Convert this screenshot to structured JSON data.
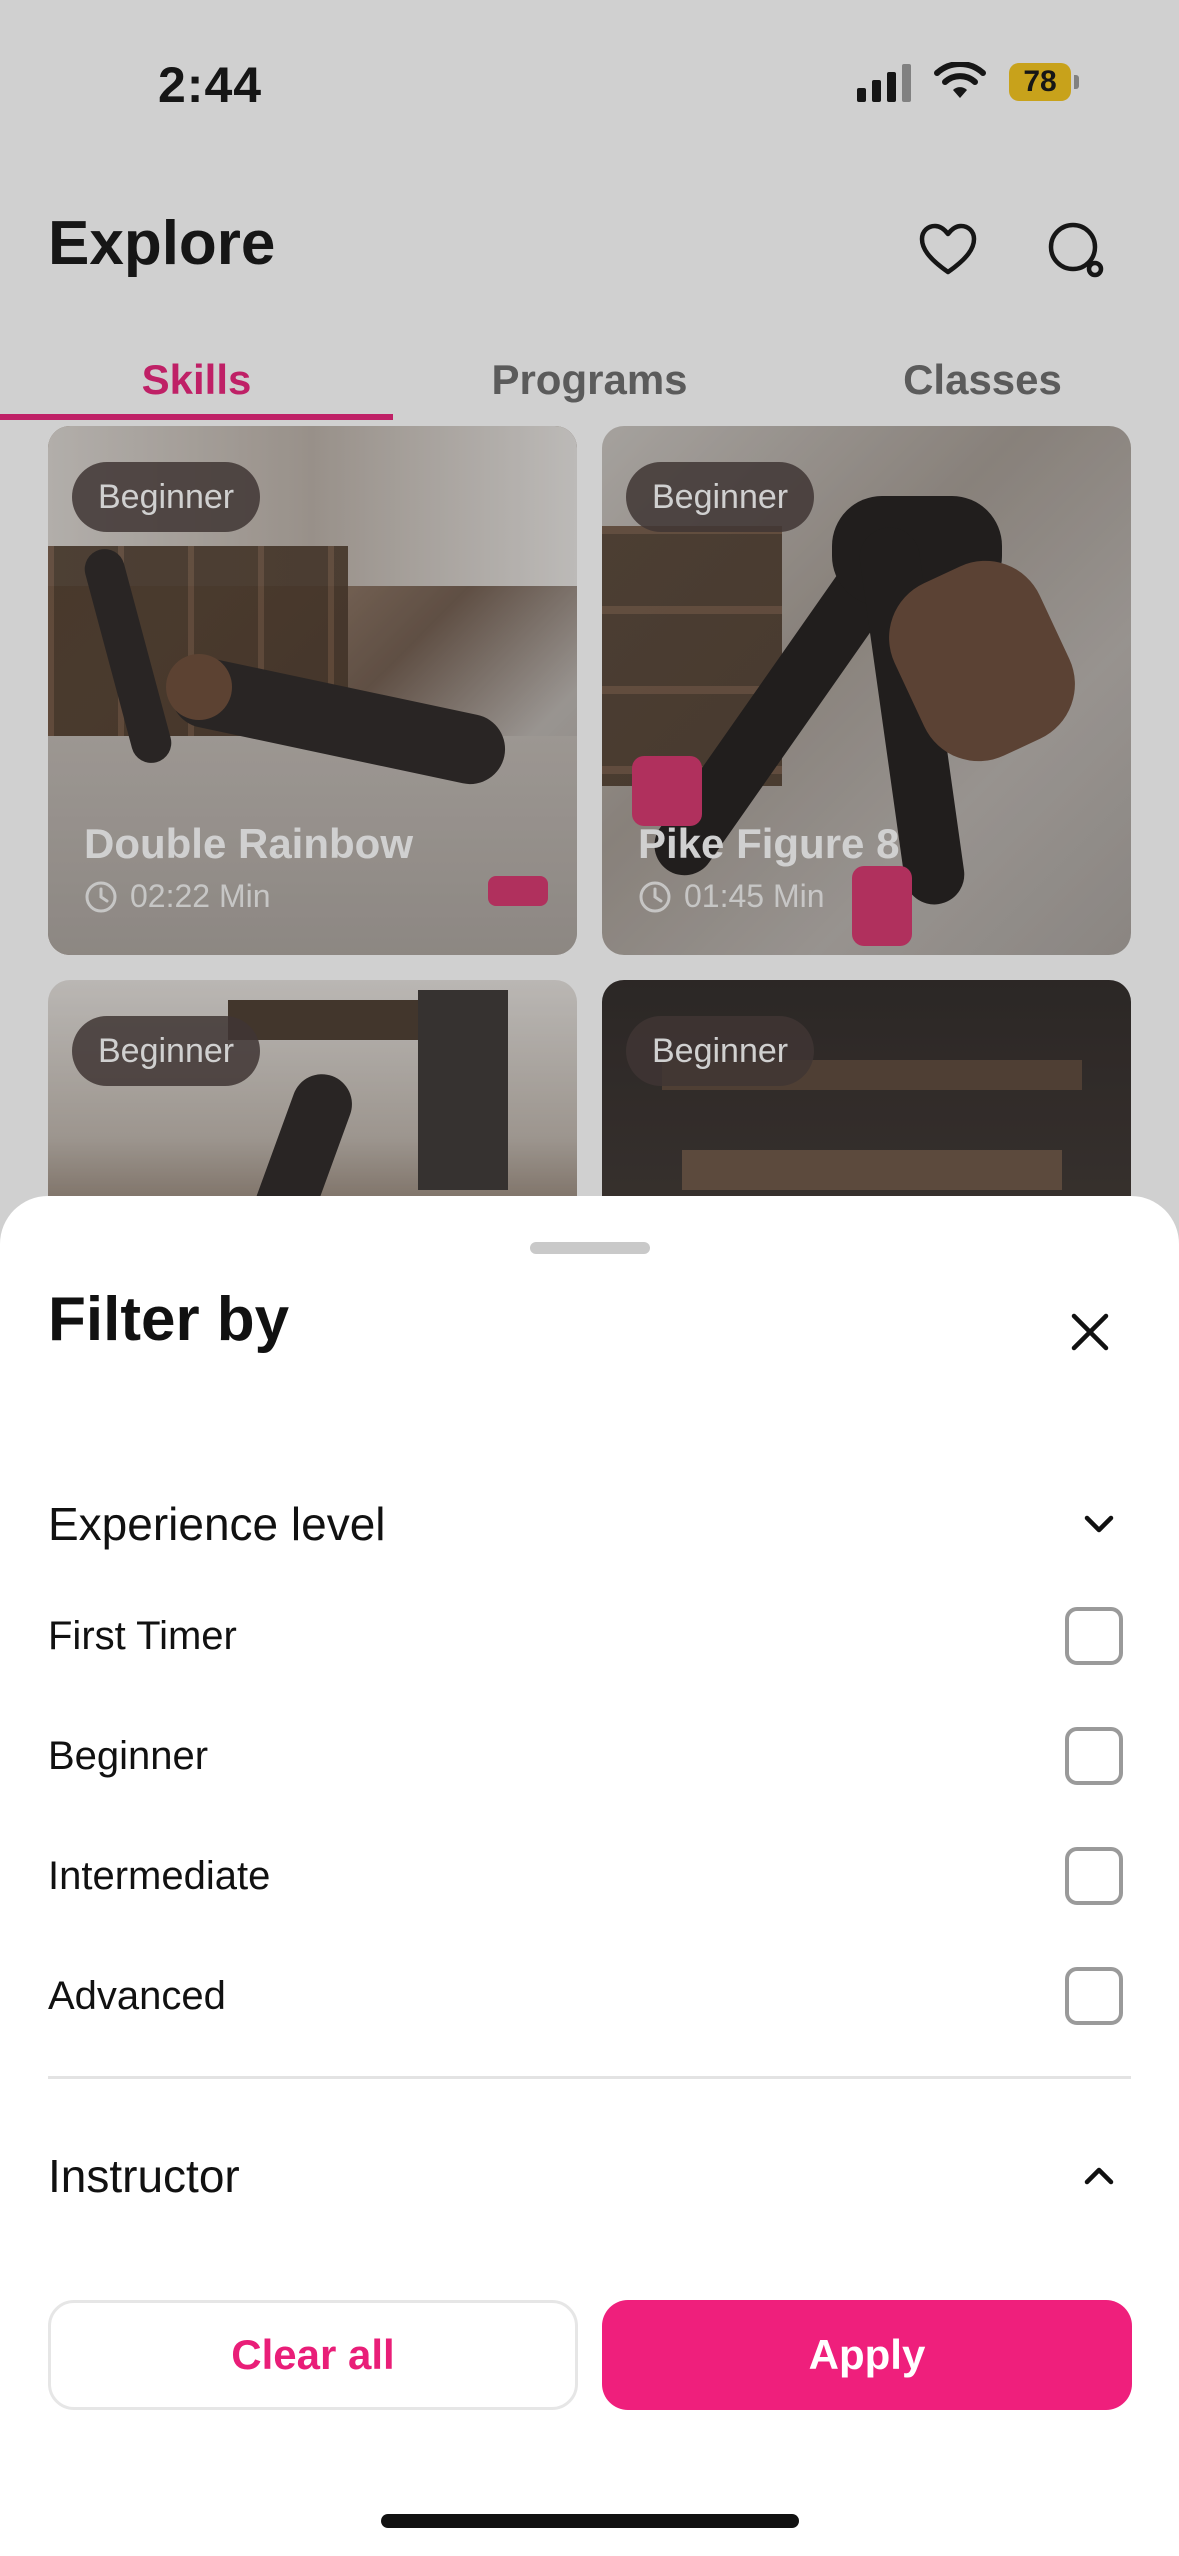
{
  "status_bar": {
    "time": "2:44",
    "battery": "78",
    "battery_color": "#f5c518"
  },
  "header": {
    "title": "Explore",
    "favorites_icon": "heart-icon",
    "search_icon": "search-icon"
  },
  "tabs": [
    {
      "label": "Skills",
      "active": true
    },
    {
      "label": "Programs",
      "active": false
    },
    {
      "label": "Classes",
      "active": false
    }
  ],
  "cards": [
    {
      "badge": "Beginner",
      "title": "Double Rainbow",
      "duration": "02:22 Min"
    },
    {
      "badge": "Beginner",
      "title": "Pike Figure 8",
      "duration": "01:45 Min"
    },
    {
      "badge": "Beginner"
    },
    {
      "badge": "Beginner"
    }
  ],
  "filter_sheet": {
    "title": "Filter by",
    "close_icon": "close-icon",
    "sections": [
      {
        "label": "Experience level",
        "expanded": true,
        "icon": "chevron-down-icon",
        "options": [
          {
            "label": "First Timer",
            "checked": false
          },
          {
            "label": "Beginner",
            "checked": false
          },
          {
            "label": "Intermediate",
            "checked": false
          },
          {
            "label": "Advanced",
            "checked": false
          }
        ]
      },
      {
        "label": "Instructor",
        "expanded": false,
        "icon": "chevron-up-icon"
      }
    ],
    "clear_label": "Clear all",
    "apply_label": "Apply"
  },
  "colors": {
    "accent": "#e91e78",
    "apply_button": "#ef1f7c"
  }
}
